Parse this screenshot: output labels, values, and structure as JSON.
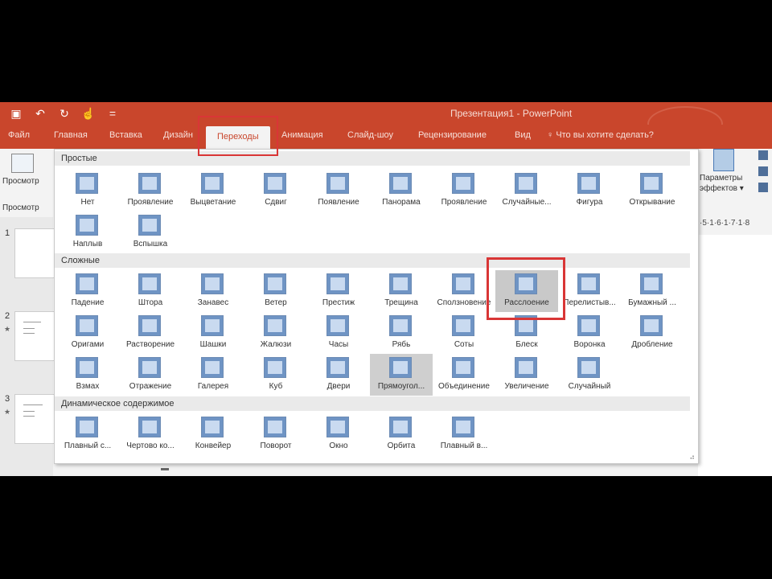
{
  "app": {
    "title": "Презентация1 - PowerPoint",
    "accent": "#c9462c"
  },
  "qat": {
    "save_icon": "save-icon",
    "undo_icon": "undo-icon",
    "redo_icon": "redo-icon",
    "touch_icon": "touch-icon",
    "customize_icon": "customize-icon"
  },
  "tabs": [
    {
      "label": "Файл"
    },
    {
      "label": "Главная"
    },
    {
      "label": "Вставка"
    },
    {
      "label": "Дизайн"
    },
    {
      "label": "Переходы"
    },
    {
      "label": "Анимация"
    },
    {
      "label": "Слайд-шоу"
    },
    {
      "label": "Рецензирование"
    },
    {
      "label": "Вид"
    }
  ],
  "help": "Что вы хотите сделать?",
  "left": {
    "preview_label": "Просмотр",
    "preview_group": "Просмотр",
    "slides": [
      "1",
      "2",
      "3"
    ]
  },
  "right": {
    "params_line1": "Параметры",
    "params_line2": "эффектов",
    "ruler": "·5·1·6·1·7·1·8"
  },
  "sections": {
    "simple": "Простые",
    "complex": "Сложные",
    "dynamic": "Динамическое содержимое"
  },
  "simple_items": [
    "Нет",
    "Проявление",
    "Выцветание",
    "Сдвиг",
    "Появление",
    "Панорама",
    "Проявление",
    "Случайные...",
    "Фигура",
    "Открывание",
    "Наплыв",
    "Вспышка"
  ],
  "complex_items": [
    "Падение",
    "Штора",
    "Занавес",
    "Ветер",
    "Престиж",
    "Трещина",
    "Сползновение",
    "Расслоение",
    "Перелистыв...",
    "Бумажный ...",
    "Оригами",
    "Растворение",
    "Шашки",
    "Жалюзи",
    "Часы",
    "Рябь",
    "Соты",
    "Блеск",
    "Воронка",
    "Дробление",
    "Взмах",
    "Отражение",
    "Галерея",
    "Куб",
    "Двери",
    "Прямоугол...",
    "Объединение",
    "Увеличение",
    "Случайный"
  ],
  "dynamic_items": [
    "Плавный с...",
    "Чертово ко...",
    "Конвейер",
    "Поворот",
    "Окно",
    "Орбита",
    "Плавный в..."
  ]
}
